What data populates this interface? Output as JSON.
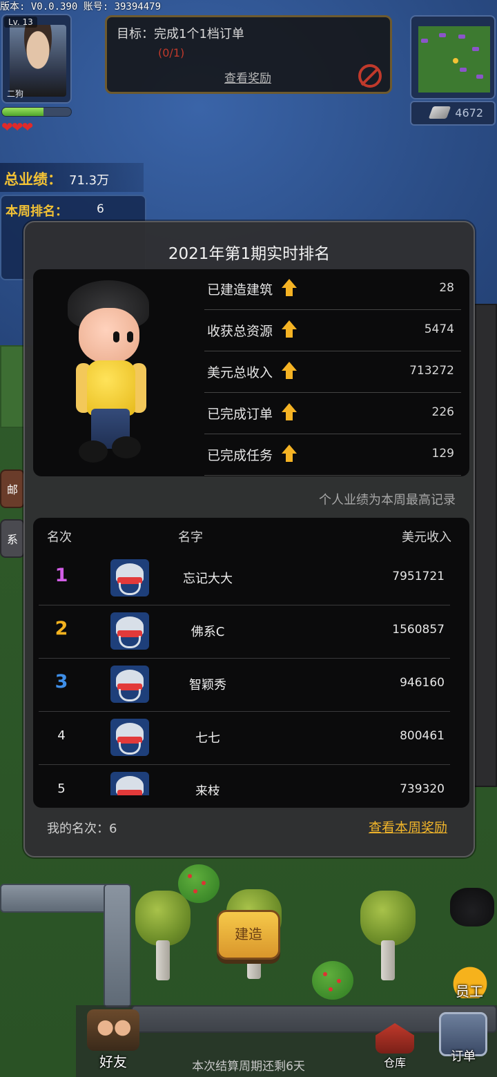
{
  "hud": {
    "version_line": "版本: V0.0.390  账号: 39394479",
    "level": "Lv. 13",
    "player_name": "二狗",
    "hp_fraction": 0.6,
    "hearts": "❤❤❤",
    "goal_title": "目标：完成1个1档订单",
    "goal_progress": "(0/1)",
    "goal_link": "查看奖励",
    "coins": "4672",
    "total_perf_label": "总业绩：",
    "total_perf_value": "71.3万",
    "week_rank_label": "本周排名：",
    "week_rank_value": "6",
    "side_buttons": [
      "邮",
      "系"
    ]
  },
  "modal": {
    "title": "2021年第1期实时排名",
    "stats": [
      {
        "label": "已建造建筑",
        "value": "28"
      },
      {
        "label": "收获总资源",
        "value": "5474"
      },
      {
        "label": "美元总收入",
        "value": "713272"
      },
      {
        "label": "已完成订单",
        "value": "226"
      },
      {
        "label": "已完成任务",
        "value": "129"
      }
    ],
    "personal_note": "个人业绩为本周最高记录",
    "columns": {
      "rank": "名次",
      "name": "名字",
      "income": "美元收入"
    },
    "rows": [
      {
        "rank": "1",
        "name": "忘记大大",
        "income": "7951721",
        "color": "#d25ee6"
      },
      {
        "rank": "2",
        "name": "佛系C",
        "income": "1560857",
        "color": "#f3b21f"
      },
      {
        "rank": "3",
        "name": "智颖秀",
        "income": "946160",
        "color": "#3f8fe8"
      },
      {
        "rank": "4",
        "name": "七七",
        "income": "800461",
        "color": "#eeeeee"
      },
      {
        "rank": "5",
        "name": "来枝",
        "income": "739320",
        "color": "#eeeeee"
      }
    ],
    "my_rank": "我的名次：6",
    "week_reward_link": "查看本周奖励"
  },
  "bottom": {
    "build": "建造",
    "friends": "好友",
    "warehouse": "仓库",
    "orders": "订单",
    "staff": "员工",
    "period_text": "本次结算周期还剩6天"
  },
  "colors": {
    "accent_gold": "#f1b52a",
    "modal_bg": "#303032",
    "card_bg": "#0b0b0c"
  }
}
